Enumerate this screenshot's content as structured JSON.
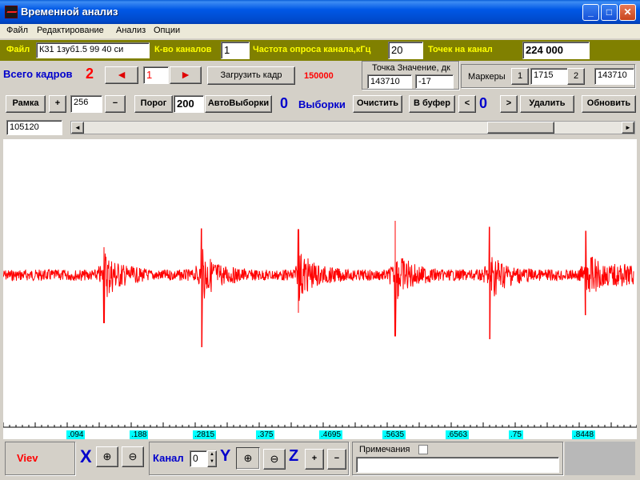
{
  "window": {
    "title": "Временной анализ",
    "min_glyph": "_",
    "max_glyph": "□",
    "close_glyph": "✕"
  },
  "menu": [
    "Файл",
    "Редактирование",
    "Анализ",
    "Опции"
  ],
  "toolbar1": {
    "file_label": "Файл",
    "file_value": "К31  1зуб1.5  99  40  си",
    "channels_label": "К-во каналов",
    "channels_value": "1",
    "rate_label": "Частота опроса канала,кГц",
    "rate_value": "20",
    "points_label": "Точек на канал",
    "points_value": "224 000"
  },
  "toolbar2": {
    "total_frames_label": "Всего кадров",
    "total_frames_value": "2",
    "prev_glyph": "◄",
    "next_glyph": "►",
    "frame_value": "1",
    "load_button": "Загрузить кадр",
    "load_count": "150000",
    "point_header": "Точка  Значение, дк",
    "point_value": "143710",
    "point_dk": "-17",
    "markers_label": "Маркеры",
    "marker1_button": "1",
    "marker1_value": "1715",
    "marker2_button": "2",
    "marker2_value": "143710"
  },
  "toolbar3": {
    "frame_button": "Рамка",
    "plus": "+",
    "frame_size": "256",
    "minus": "−",
    "threshold_button": "Порог",
    "threshold_value": "200",
    "auto_button": "АвтоВыборки",
    "samples_count": "0",
    "samples_label": "Выборки",
    "clear_button": "Очистить",
    "buffer_button": "В буфер",
    "nav_prev": "<",
    "buffer_count": "0",
    "nav_next": ">",
    "delete_button": "Удалить",
    "refresh_button": "Обновить"
  },
  "scroll": {
    "position_value": "105120",
    "left_arrow": "◄",
    "right_arrow": "►"
  },
  "axis": {
    "ticks": [
      ".094",
      ".188",
      ".2815",
      ".375",
      ".4695",
      ".5635",
      ".6563",
      ".75",
      ".8448"
    ]
  },
  "bottom": {
    "view_label": "Viev",
    "x_label": "X",
    "channel_label": "Канал",
    "channel_value": "0",
    "y_label": "Y",
    "z_label": "Z",
    "plus": "+",
    "minus": "−",
    "notes_label": "Примечания"
  },
  "colors": {
    "signal": "#ff0000",
    "olive": "#808000",
    "label_yellow": "#ffff00",
    "blue_label": "#0000cc",
    "red_label": "#ff0000"
  }
}
